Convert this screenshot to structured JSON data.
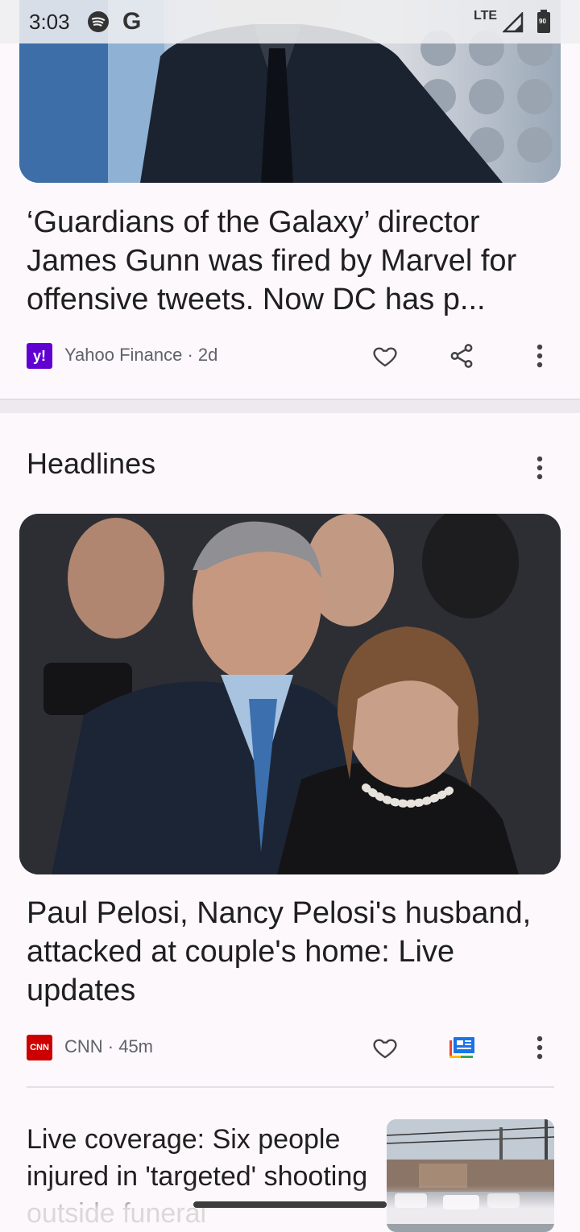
{
  "status_bar": {
    "time": "3:03",
    "network": "LTE",
    "battery_level": "90",
    "icons": [
      "spotify-icon",
      "google-icon",
      "signal-icon",
      "battery-icon"
    ]
  },
  "story1": {
    "image_alt": "Man in dark suit and tie",
    "headline": "‘Guardians of the Galaxy’ director James Gunn was fired by Marvel for offensive tweets. Now DC has p...",
    "source_logo": "y!",
    "source_logo_color": "#6001d2",
    "meta": "Yahoo Finance · 2d"
  },
  "section": {
    "title": "Headlines"
  },
  "story2": {
    "image_alt": "Paul Pelosi and Nancy Pelosi in a crowd",
    "headline": "Paul Pelosi, Nancy Pelosi's husband, attacked at couple's home: Live updates",
    "source_logo": "CNN",
    "source_logo_color": "#cc0000",
    "meta": "CNN · 45m"
  },
  "story3": {
    "headline": "Live coverage: Six people injured in 'targeted' shooting outside funeral",
    "image_alt": "Street scene with police vehicles"
  }
}
